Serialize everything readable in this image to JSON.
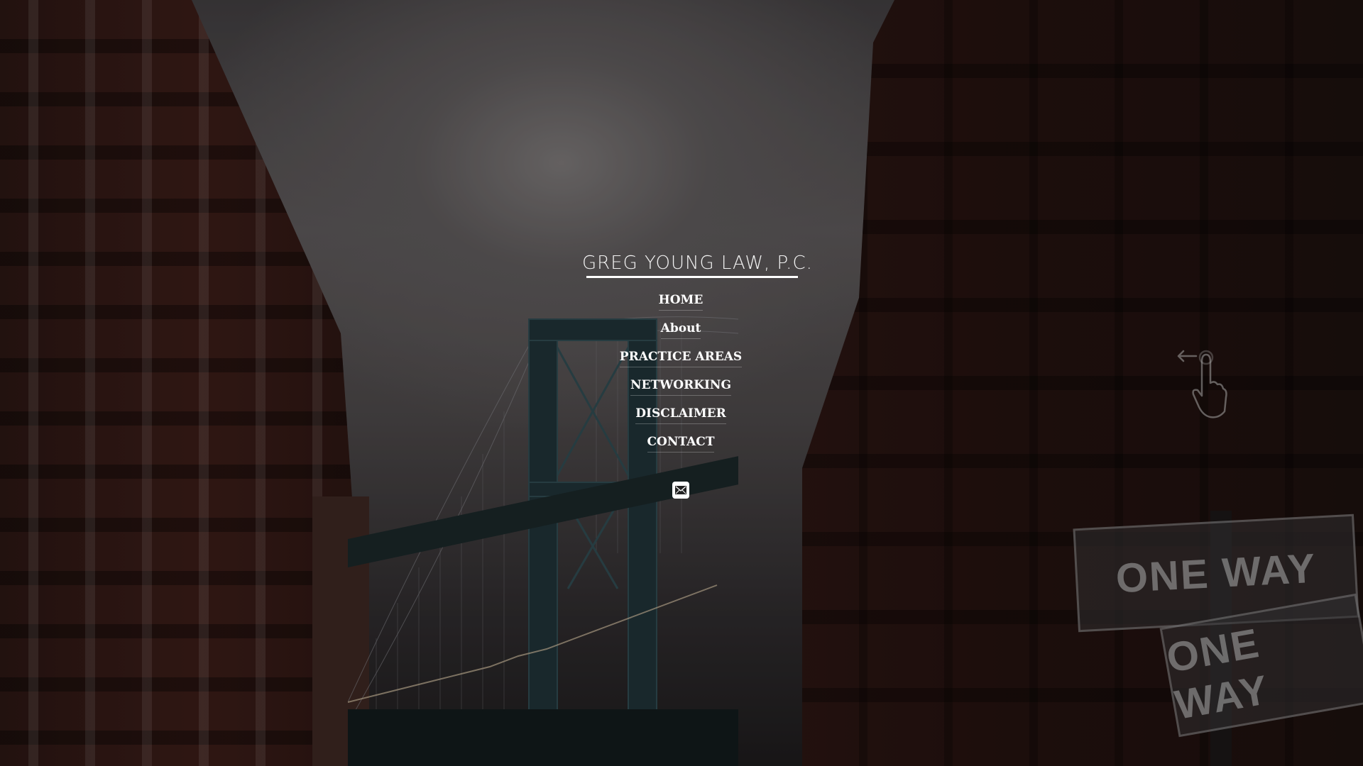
{
  "site": {
    "title": "GREG YOUNG LAW, P.C."
  },
  "nav": {
    "items": [
      {
        "label": "HOME"
      },
      {
        "label": "About"
      },
      {
        "label": "PRACTICE AREAS"
      },
      {
        "label": "NETWORKING"
      },
      {
        "label": "DISCLAIMER"
      },
      {
        "label": "CONTACT"
      }
    ]
  },
  "social": {
    "icon": "mail-icon"
  },
  "background": {
    "sign_top": "ONE WAY",
    "sign_bottom": "ONE WAY"
  },
  "colors": {
    "text": "#ffffff",
    "building_brick": "#3a1c17",
    "sky": "#5a5657"
  }
}
